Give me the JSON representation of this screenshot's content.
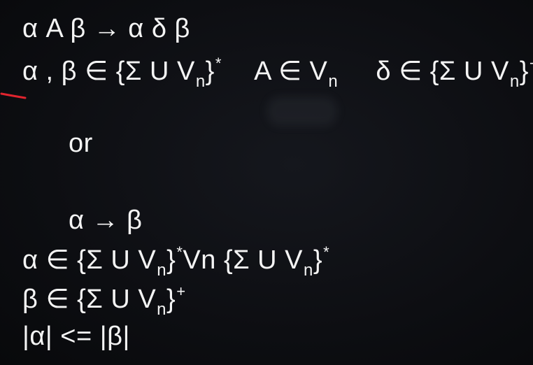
{
  "line1": {
    "text": "α A β → α δ β"
  },
  "line2": {
    "part1": "α , β ∈ {Σ U V",
    "part1_sub": "n",
    "part1_close": "}",
    "part1_sup": "*",
    "part2": "A ∈ V",
    "part2_sub": "n",
    "part3": "δ ∈ {Σ U V",
    "part3_sub": "n",
    "part3_close": "}",
    "part3_sup": "+"
  },
  "or_text": "or",
  "line4": {
    "text": "α → β"
  },
  "line5": {
    "part1": "α ∈ {Σ U V",
    "part1_sub": "n",
    "part1_close": "}",
    "part1_sup": "*",
    "part2": " Vn {Σ U V",
    "part2_sub": "n",
    "part2_close": "}",
    "part2_sup": "*"
  },
  "line6": {
    "part1": "β ∈ {Σ U V",
    "part1_sub": "n",
    "part1_close": "}",
    "part1_sup": "+"
  },
  "line7": {
    "text": "|α| <= |β|"
  },
  "colors": {
    "background": "#0b0c10",
    "text": "#f4f4f4",
    "red_mark": "#e0242e"
  }
}
